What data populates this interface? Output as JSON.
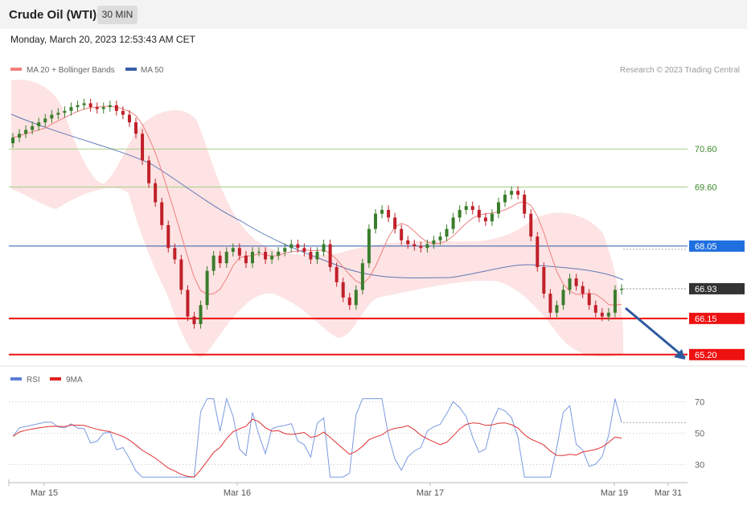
{
  "header": {
    "title": "Crude Oil (WTI)",
    "interval": "30 MIN"
  },
  "datetime": "Monday, March 20, 2023 12:53:43 AM CET",
  "legend_main": [
    {
      "label": "MA 20 + Bollinger Bands",
      "color": "#f08080"
    },
    {
      "label": "MA 50",
      "color": "#3a5ea8"
    }
  ],
  "legend_rsi": [
    {
      "label": "RSI",
      "color": "#5b7fd6"
    },
    {
      "label": "9MA",
      "color": "#e02020"
    }
  ],
  "copyright": "Research © 2023 Trading Central",
  "colors": {
    "up": "#3a7d2c",
    "down": "#c0202a",
    "resistance": "#a6cf86",
    "pivot": "#2a5aa8",
    "support": "#ee1111",
    "band": "#fde3e3",
    "arrow": "#2e5aa0"
  },
  "chart_data": {
    "type": "candlestick",
    "ylim": [
      64.9,
      72.4
    ],
    "x_labels": [
      "Mar 15",
      "Mar 16",
      "Mar 17",
      "Mar 19",
      "Mar 31"
    ],
    "levels": [
      {
        "value": 70.6,
        "label": "70.60",
        "kind": "resistance"
      },
      {
        "value": 69.6,
        "label": "69.60",
        "kind": "resistance"
      },
      {
        "value": 68.05,
        "label": "68.05",
        "kind": "pivot"
      },
      {
        "value": 66.15,
        "label": "66.15",
        "kind": "support"
      },
      {
        "value": 65.2,
        "label": "65.20",
        "kind": "support"
      }
    ],
    "last_price": {
      "value": 66.93,
      "label": "66.93"
    },
    "candles_close": [
      70.9,
      71.0,
      71.1,
      71.2,
      71.3,
      71.4,
      71.5,
      71.55,
      71.6,
      71.7,
      71.75,
      71.8,
      71.7,
      71.65,
      71.7,
      71.75,
      71.6,
      71.5,
      71.3,
      71.0,
      70.3,
      69.7,
      69.2,
      68.6,
      68.0,
      67.7,
      66.9,
      66.2,
      66.0,
      66.5,
      67.4,
      67.8,
      67.6,
      67.9,
      68.0,
      67.8,
      67.6,
      67.9,
      67.9,
      67.7,
      67.8,
      67.9,
      68.0,
      68.1,
      68.0,
      67.9,
      67.7,
      67.9,
      68.1,
      67.5,
      67.1,
      66.7,
      66.5,
      66.9,
      67.6,
      68.5,
      68.9,
      69.0,
      68.8,
      68.5,
      68.2,
      68.1,
      68.05,
      68.0,
      68.1,
      68.2,
      68.3,
      68.5,
      68.8,
      69.0,
      69.1,
      69.0,
      68.8,
      68.7,
      68.9,
      69.2,
      69.4,
      69.5,
      69.4,
      68.9,
      68.3,
      67.5,
      66.8,
      66.3,
      66.5,
      66.9,
      67.2,
      67.0,
      66.8,
      66.5,
      66.3,
      66.2,
      66.3,
      66.9,
      66.93
    ],
    "rsi": {
      "ylim": [
        20,
        80
      ],
      "levels": [
        70,
        50,
        30
      ]
    }
  }
}
